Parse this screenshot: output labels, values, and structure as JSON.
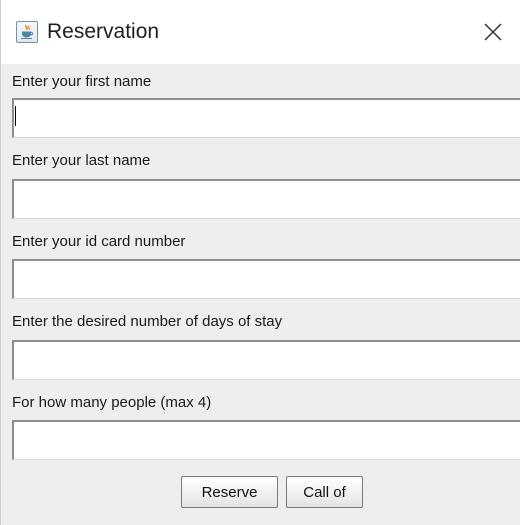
{
  "window": {
    "title": "Reservation",
    "icon": "java-coffee-cup-icon",
    "close_icon": "close-icon"
  },
  "form": {
    "fields": [
      {
        "label": "Enter your first name",
        "value": "",
        "placeholder": ""
      },
      {
        "label": "Enter your last name",
        "value": "",
        "placeholder": ""
      },
      {
        "label": "Enter your id card number",
        "value": "",
        "placeholder": ""
      },
      {
        "label": "Enter the desired number of days of stay",
        "value": "",
        "placeholder": ""
      },
      {
        "label": "For how many people (max 4)",
        "value": "",
        "placeholder": ""
      }
    ]
  },
  "buttons": {
    "reserve_label": "Reserve",
    "cancel_label": "Call of"
  }
}
